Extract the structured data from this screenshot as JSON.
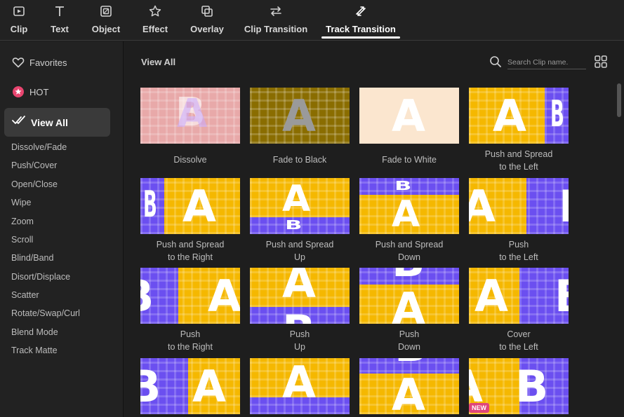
{
  "toolbar": {
    "tabs": [
      {
        "label": "Clip",
        "icon": "clip-icon"
      },
      {
        "label": "Text",
        "icon": "text-icon"
      },
      {
        "label": "Object",
        "icon": "object-icon"
      },
      {
        "label": "Effect",
        "icon": "effect-icon"
      },
      {
        "label": "Overlay",
        "icon": "overlay-icon"
      },
      {
        "label": "Clip Transition",
        "icon": "clip-transition-icon"
      },
      {
        "label": "Track Transition",
        "icon": "track-transition-icon",
        "active": true
      }
    ]
  },
  "sidebar": {
    "favorites": "Favorites",
    "hot": "HOT",
    "view_all": "View All",
    "categories": [
      "Dissolve/Fade",
      "Push/Cover",
      "Open/Close",
      "Wipe",
      "Zoom",
      "Scroll",
      "Blind/Band",
      "Disort/Displace",
      "Scatter",
      "Rotate/Swap/Curl",
      "Blend Mode",
      "Track Matte"
    ]
  },
  "main": {
    "title": "View All",
    "search_placeholder": "Search Clip name.",
    "items": [
      {
        "line1": "Dissolve",
        "line2": ""
      },
      {
        "line1": "Fade to Black",
        "line2": ""
      },
      {
        "line1": "Fade to White",
        "line2": ""
      },
      {
        "line1": "Push and Spread",
        "line2": "to the Left"
      },
      {
        "line1": "Push and Spread",
        "line2": "to the Right"
      },
      {
        "line1": "Push and Spread",
        "line2": "Up"
      },
      {
        "line1": "Push and Spread",
        "line2": "Down"
      },
      {
        "line1": "Push",
        "line2": "to the Left"
      },
      {
        "line1": "Push",
        "line2": "to the Right"
      },
      {
        "line1": "Push",
        "line2": "Up"
      },
      {
        "line1": "Push",
        "line2": "Down"
      },
      {
        "line1": "Cover",
        "line2": "to the Left"
      },
      {
        "line1": "",
        "line2": ""
      },
      {
        "line1": "",
        "line2": ""
      },
      {
        "line1": "",
        "line2": ""
      },
      {
        "line1": "",
        "line2": "",
        "badge": "NEW"
      }
    ]
  },
  "colors": {
    "yellow": "#f5b800",
    "purple": "#6b4ff0",
    "pink": "#e8a9a9",
    "dark_yellow": "#8a6d00",
    "cream": "#fbe6cf",
    "badge": "#e0457b"
  }
}
